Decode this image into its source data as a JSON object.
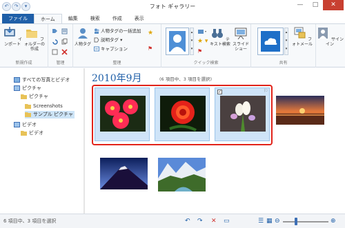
{
  "window": {
    "title": "フォト ギャラリー",
    "min": "—",
    "max": "□",
    "close": "✕"
  },
  "qat": [
    "↶",
    "↷",
    "▾"
  ],
  "tabs": [
    "ファイル",
    "ホーム",
    "編集",
    "検索",
    "作成",
    "表示"
  ],
  "ribbon": {
    "groups": [
      "新規作成",
      "管理",
      "整理",
      "クイック検索",
      "共有"
    ],
    "new_import": "インポート",
    "new_folder": "フォルダーの作成",
    "people_tag": "人物タグ",
    "bulk_people": "人物タグの一括追加",
    "desc_tag": "説明タグ",
    "caption": "キャプション",
    "text_search": "テキスト検索",
    "slideshow": "スライドショー",
    "photo_mail": "フォトメール",
    "signin": "サインイン"
  },
  "sidebar": {
    "items": [
      "すべての写真とビデオ",
      "ピクチャ",
      "ピクチャ",
      "Screenshots",
      "サンプル ピクチャ",
      "ビデオ",
      "ビデオ"
    ]
  },
  "main": {
    "heading": "2010年9月",
    "subheading": "(6 項目中、3 項目を選択)",
    "photos": [
      "gerbera",
      "rose",
      "bouquet",
      "sunset",
      "mountain",
      "valley"
    ]
  },
  "status": {
    "text": "6 項目中、3 項目を選択"
  },
  "colors": {
    "accent": "#1f5fa8",
    "selection": "#cfe4f8",
    "highlight_frame": "#e2231a"
  }
}
